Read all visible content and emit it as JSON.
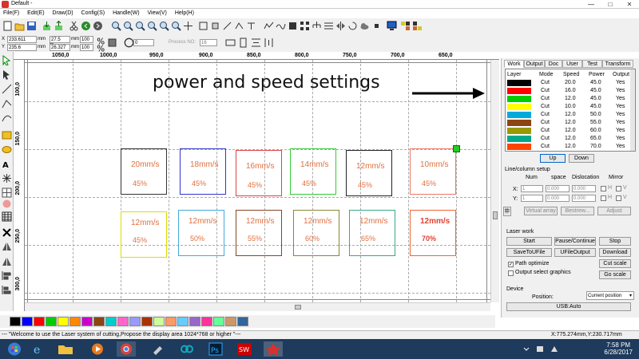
{
  "window": {
    "title": "Default - ",
    "controls": [
      "—",
      "□",
      "✕"
    ]
  },
  "menu": [
    "File(F)",
    "Edit(E)",
    "Draw(D)",
    "Config(S)",
    "Handle(W)",
    "View(V)",
    "Help(H)"
  ],
  "props": {
    "x_label": "X",
    "x_value": "233.611",
    "y_label": "Y",
    "y_value": "235.6",
    "mm1": "mm",
    "mm2": "mm",
    "w_value": "27.5",
    "h_value": "26.327",
    "mm3": "mm",
    "mm4": "mm",
    "pct1": "100",
    "pct2": "100",
    "angle_value": "0",
    "process_no_label": "Process NO:",
    "process_no_value": "16"
  },
  "ruler": {
    "h_labels": [
      "1050,0",
      "1000,0",
      "950,0",
      "900,0",
      "850,0",
      "800,0",
      "750,0",
      "700,0",
      "650,0"
    ],
    "v_labels": [
      "100,0",
      "150,0",
      "200,0",
      "250,0",
      "300,0"
    ]
  },
  "canvas": {
    "annotation": "power and speed settings",
    "row1": [
      {
        "speed": "20mm/s",
        "power": "45%",
        "color": "#333333"
      },
      {
        "speed": "18mm/s",
        "power": "45%",
        "color": "#3333cc"
      },
      {
        "speed": "16mm/s",
        "power": "45%",
        "color": "#dd4444"
      },
      {
        "speed": "14mm/s",
        "power": "45%",
        "color": "#33cc33"
      },
      {
        "speed": "12mm/s",
        "power": "45%",
        "color": "#222222"
      },
      {
        "speed": "10mm/s",
        "power": "45%",
        "color": "#ee7766"
      }
    ],
    "row2": [
      {
        "speed": "12mm/s",
        "power": "45%",
        "color": "#dddd00"
      },
      {
        "speed": "12mm/s",
        "power": "50%",
        "color": "#44aadd"
      },
      {
        "speed": "12mm/s",
        "power": "55%",
        "color": "#884422"
      },
      {
        "speed": "12mm/s",
        "power": "60%",
        "color": "#888833"
      },
      {
        "speed": "12mm/s",
        "power": "65%",
        "color": "#33aa88"
      },
      {
        "speed": "12mm/s",
        "power": "70%",
        "color": "#ee6633"
      }
    ]
  },
  "palette": [
    "#000000",
    "#0000ff",
    "#ff0000",
    "#00cc00",
    "#ffff00",
    "#ff8800",
    "#cc00cc",
    "#8b4513",
    "#00cccc",
    "#ff66cc",
    "#9999ff",
    "#aa3300",
    "#ccff99",
    "#ff9966",
    "#66ccff",
    "#9966cc",
    "#ff3399",
    "#66ff99",
    "#cc9966",
    "#336699"
  ],
  "panel": {
    "tabs": [
      "Work",
      "Output",
      "Doc",
      "User",
      "Test",
      "Transform"
    ],
    "layer_headers": [
      "Layer",
      "Mode",
      "Speed",
      "Power",
      "Output"
    ],
    "layers": [
      {
        "color": "#000000",
        "mode": "Cut",
        "speed": "20.0",
        "power": "45.0",
        "output": "Yes"
      },
      {
        "color": "#ff0000",
        "mode": "Cut",
        "speed": "16.0",
        "power": "45.0",
        "output": "Yes"
      },
      {
        "color": "#00cc00",
        "mode": "Cut",
        "speed": "12.0",
        "power": "45.0",
        "output": "Yes"
      },
      {
        "color": "#ffff00",
        "mode": "Cut",
        "speed": "10.0",
        "power": "45.0",
        "output": "Yes"
      },
      {
        "color": "#00aadd",
        "mode": "Cut",
        "speed": "12.0",
        "power": "50.0",
        "output": "Yes"
      },
      {
        "color": "#8b4513",
        "mode": "Cut",
        "speed": "12.0",
        "power": "55.0",
        "output": "Yes"
      },
      {
        "color": "#999900",
        "mode": "Cut",
        "speed": "12.0",
        "power": "60.0",
        "output": "Yes"
      },
      {
        "color": "#00aa88",
        "mode": "Cut",
        "speed": "12.0",
        "power": "65.0",
        "output": "Yes"
      },
      {
        "color": "#ff4400",
        "mode": "Cut",
        "speed": "12.0",
        "power": "70.0",
        "output": "Yes"
      }
    ],
    "up": "Up",
    "down": "Down",
    "line_col_setup": "Line/column setup",
    "num": "Num",
    "space": "space",
    "dislocation": "Dislocation",
    "mirror": "Mirror",
    "x": "X:",
    "y": "Y:",
    "x_num": "1",
    "y_num": "1",
    "x_space": "0.000",
    "y_space": "0.000",
    "x_disl": "0.000",
    "y_disl": "0.000",
    "mirror_h": "H",
    "mirror_v": "V",
    "virtual_array": "Virtual array",
    "bestrew": "Bestrew...",
    "adjust": "Adjust",
    "laser_work": "Laser work",
    "start": "Start",
    "pause": "Pause/Continue",
    "stop": "Stop",
    "save_to_ufile": "SaveToUFile",
    "ufile_output": "UFileOutput",
    "download": "Download",
    "path_optimize": "Path optimize",
    "output_select": "Output select graphics",
    "cut_scale": "Cut scale",
    "go_scale": "Go scale",
    "device": "Device",
    "position_label": "Position:",
    "position_value": "Current position",
    "usb": "USB:Auto"
  },
  "status": {
    "message": "--- \"Welcome to use the Laser system of cutting,Propose the display area 1024*768 or higher \"---",
    "coords": "X:775.274mm,Y:230.717mm"
  },
  "taskbar": {
    "time": "7:58 PM",
    "date": "6/28/2017"
  }
}
